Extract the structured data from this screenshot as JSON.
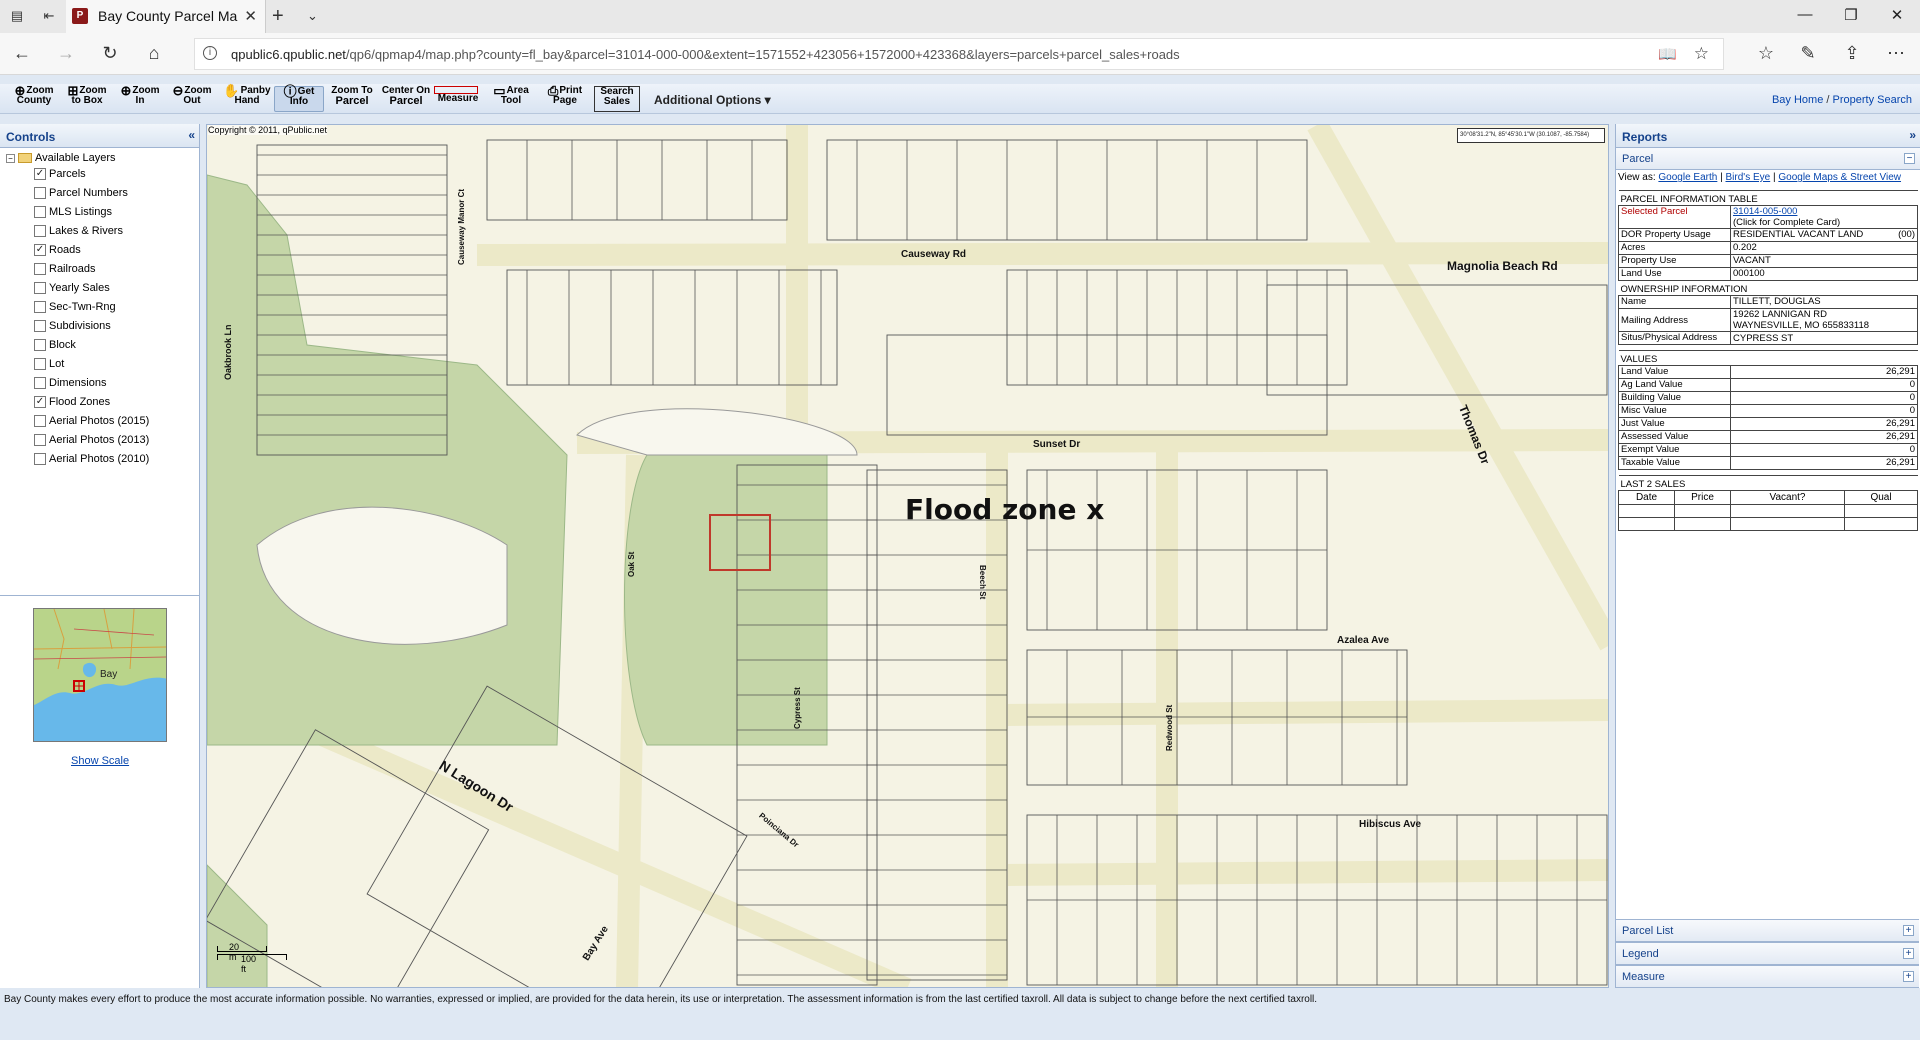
{
  "browser": {
    "tab_title": "Bay County Parcel Maps",
    "url_host": "qpublic6.qpublic.net",
    "url_path": "/qp6/qpmap4/map.php?county=fl_bay&parcel=31014-000-000&extent=1571552+423056+1572000+423368&layers=parcels+parcel_sales+roads"
  },
  "toolbar": {
    "tools": [
      {
        "l1": "Zoom",
        "l2": "County"
      },
      {
        "l1": "Zoom",
        "l2": "to Box"
      },
      {
        "l1": "Zoom",
        "l2": "In"
      },
      {
        "l1": "Zoom",
        "l2": "Out"
      },
      {
        "l1": "Panby",
        "l2": "Hand"
      },
      {
        "l1": "Get",
        "l2": "Info"
      },
      {
        "l1": "Zoom To",
        "l2": "Parcel"
      },
      {
        "l1": "Center On",
        "l2": "Parcel"
      },
      {
        "l1": "",
        "l2": "Measure"
      },
      {
        "l1": "Area",
        "l2": "Tool"
      },
      {
        "l1": "Print",
        "l2": "Page"
      },
      {
        "l1": "Search",
        "l2": "Sales"
      }
    ],
    "additional_options": "Additional Options",
    "link_bay_home": "Bay Home",
    "link_sep": "/",
    "link_property_search": "Property Search"
  },
  "controls": {
    "title": "Controls",
    "root": "Available Layers",
    "layers": [
      {
        "label": "Parcels",
        "checked": true
      },
      {
        "label": "Parcel Numbers",
        "checked": false
      },
      {
        "label": "MLS Listings",
        "checked": false
      },
      {
        "label": "Lakes & Rivers",
        "checked": false
      },
      {
        "label": "Roads",
        "checked": true
      },
      {
        "label": "Railroads",
        "checked": false
      },
      {
        "label": "Yearly Sales",
        "checked": false
      },
      {
        "label": "Sec-Twn-Rng",
        "checked": false
      },
      {
        "label": "Subdivisions",
        "checked": false
      },
      {
        "label": "Block",
        "checked": false
      },
      {
        "label": "Lot",
        "checked": false
      },
      {
        "label": "Dimensions",
        "checked": false
      },
      {
        "label": "Flood Zones",
        "checked": true
      },
      {
        "label": "Aerial Photos (2015)",
        "checked": false
      },
      {
        "label": "Aerial Photos (2013)",
        "checked": false
      },
      {
        "label": "Aerial Photos (2010)",
        "checked": false
      }
    ],
    "overview_label": "Bay",
    "show_scale": "Show Scale"
  },
  "map": {
    "copyright": "Copyright © 2011, qPublic.net",
    "coords": "30°08'31.2\"N, 85°45'30.1\"W (30.1087, -85.7584)",
    "annotation": "Flood zone x",
    "scale_m": "20 m",
    "scale_ft": "100 ft",
    "roads": {
      "causeway_rd": "Causeway Rd",
      "magnolia": "Magnolia Beach Rd",
      "sunset": "Sunset Dr",
      "thomas": "Thomas Dr",
      "causeway_manor": "Causeway Manor Ct",
      "oakbrook": "Oakbrook Ln",
      "oak": "Oak St",
      "beech": "Beech St",
      "cypress": "Cypress St",
      "azalea": "Azalea Ave",
      "redwood": "Redwood St",
      "lagoon": "N Lagoon Dr",
      "poinciana": "Poinciana Dr",
      "hibiscus": "Hibiscus Ave",
      "bay": "Bay Ave"
    }
  },
  "reports": {
    "title": "Reports",
    "parcel_title": "Parcel",
    "view_as": "View as:",
    "google_earth": "Google Earth",
    "birds_eye": "Bird's Eye",
    "google_maps": "Google Maps & Street View",
    "pit_header": "PARCEL INFORMATION TABLE",
    "selected_parcel_label": "Selected Parcel",
    "selected_parcel": "31014-005-000",
    "click_card": "(Click for Complete Card)",
    "dor_label": "DOR Property Usage",
    "dor_value": "RESIDENTIAL VACANT LAND",
    "dor_code": "(00)",
    "acres_label": "Acres",
    "acres": "0.202",
    "property_use_label": "Property Use",
    "property_use": "VACANT",
    "land_use_label": "Land Use",
    "land_use": "000100",
    "ownership_header": "OWNERSHIP INFORMATION",
    "name_label": "Name",
    "name": "TILLETT, DOUGLAS",
    "mailing_label": "Mailing Address",
    "mailing1": "19262 LANNIGAN RD",
    "mailing2": "WAYNESVILLE, MO 655833118",
    "situs_label": "Situs/Physical Address",
    "situs": "CYPRESS ST",
    "values_header": "VALUES",
    "values": [
      {
        "label": "Land Value",
        "value": "26,291"
      },
      {
        "label": "Ag Land Value",
        "value": "0"
      },
      {
        "label": "Building Value",
        "value": "0"
      },
      {
        "label": "Misc Value",
        "value": "0"
      },
      {
        "label": "Just Value",
        "value": "26,291"
      },
      {
        "label": "Assessed Value",
        "value": "26,291"
      },
      {
        "label": "Exempt Value",
        "value": "0"
      },
      {
        "label": "Taxable Value",
        "value": "26,291"
      }
    ],
    "sales_header": "LAST 2 SALES",
    "sales_cols": [
      "Date",
      "Price",
      "Vacant?",
      "Qual"
    ],
    "parcel_list": "Parcel List",
    "legend": "Legend",
    "measure": "Measure"
  },
  "footer": {
    "disclaimer": "Bay County makes every effort to produce the most accurate information possible. No warranties, expressed or implied, are provided for the data herein, its use or interpretation. The assessment information is from the last certified taxroll. All data is subject to change before the next certified taxroll."
  }
}
